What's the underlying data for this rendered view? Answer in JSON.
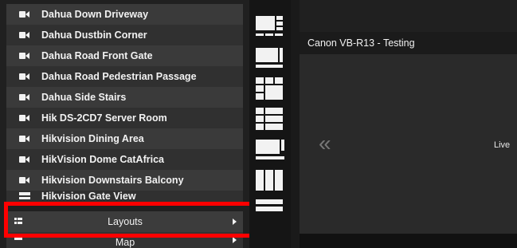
{
  "cameras": [
    "Dahua Down Driveway",
    "Dahua Dustbin Corner",
    "Dahua Road Front Gate",
    "Dahua Road Pedestrian Passage",
    "Dahua Side Stairs",
    "Hik DS-2CD7 Server Room",
    "Hikvision Dining Area",
    "HikVision Dome CatAfrica",
    "Hikvision Downstairs Balcony",
    "Hikvision Gate View"
  ],
  "menu": {
    "layouts_label": "Layouts",
    "map_label": "Map"
  },
  "viewer": {
    "title": "Canon VB-R13 - Testing",
    "status_text": "Live"
  },
  "colors": {
    "highlight": "#ff0000",
    "panel_bg": "#202020",
    "text": "#f2f2f2"
  },
  "icons": [
    "camera-icon",
    "layouts-icon",
    "map-icon",
    "chevron-right-icon",
    "double-chevron-left-icon"
  ]
}
